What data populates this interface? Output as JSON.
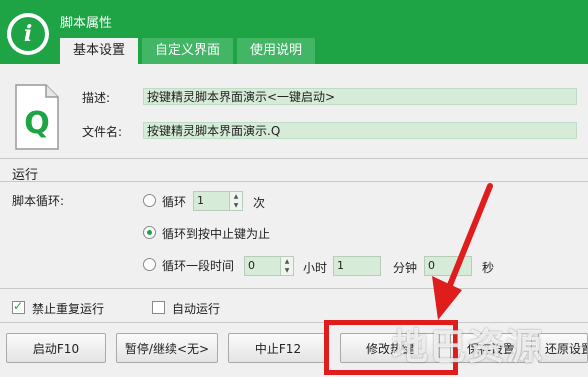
{
  "window": {
    "title": "脚本属性"
  },
  "tabs": [
    {
      "label": "基本设置",
      "active": true
    },
    {
      "label": "自定义界面",
      "active": false
    },
    {
      "label": "使用说明",
      "active": false
    }
  ],
  "fields": {
    "desc_label": "描述:",
    "desc_value": "按键精灵脚本界面演示<一键启动>",
    "filename_label": "文件名:",
    "filename_value": "按键精灵脚本界面演示.Q"
  },
  "run": {
    "section_title": "运行",
    "loop_label": "脚本循环:",
    "opt_loop": "循环",
    "loop_count": "1",
    "loop_unit": "次",
    "opt_until_stop": "循环到按中止键为止",
    "opt_period": "循环一段时间",
    "hours": "0",
    "hours_unit": "小时",
    "minutes": "1",
    "minutes_unit": "分钟",
    "seconds": "0",
    "seconds_unit": "秒"
  },
  "options": {
    "no_repeat": "禁止重复运行",
    "no_repeat_checked": true,
    "auto_run": "自动运行",
    "auto_run_checked": false
  },
  "buttons": {
    "start": "启动F10",
    "pause": "暂停/继续<无>",
    "stop": "中止F12",
    "hotkey": "修改热键",
    "save": "保存设置",
    "restore": "还原设置"
  },
  "watermark": "地巴资源",
  "colors": {
    "accent": "#1ea445",
    "highlight": "#e01d1d"
  }
}
